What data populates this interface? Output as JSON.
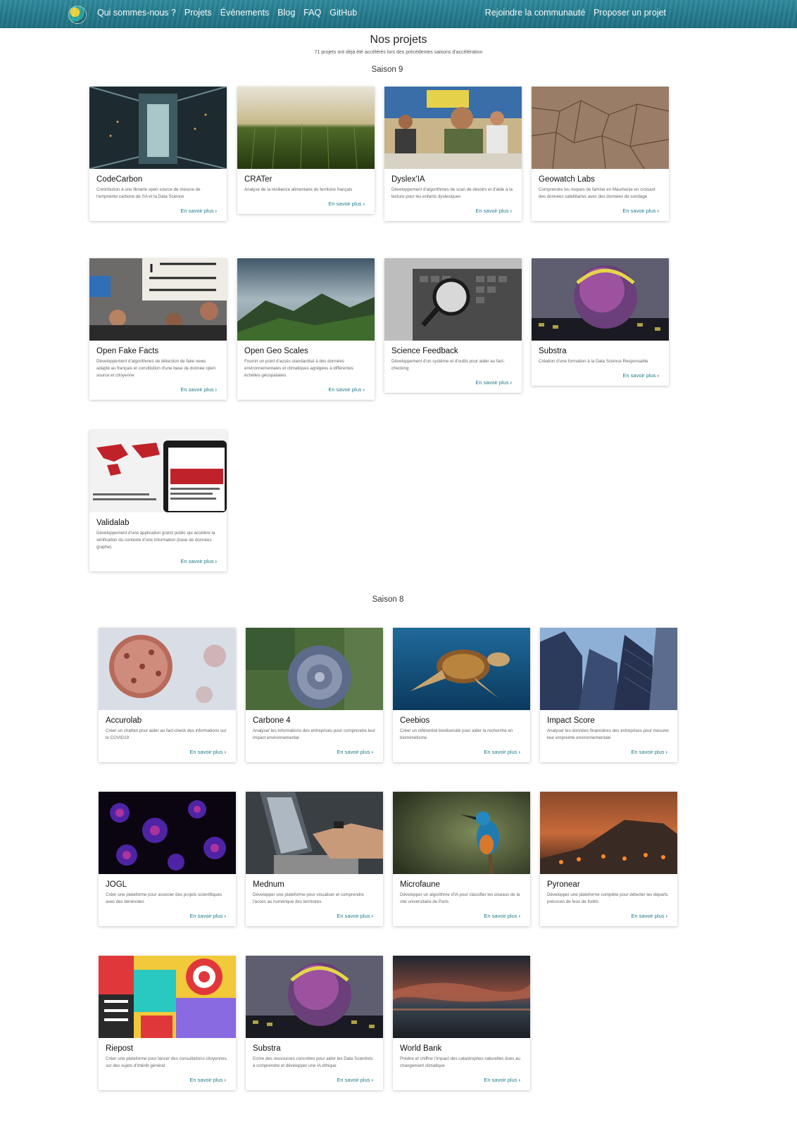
{
  "nav": {
    "left": [
      "Qui sommes-nous ?",
      "Projets",
      "Évènements",
      "Blog",
      "FAQ",
      "GitHub"
    ],
    "right": [
      "Rejoindre la communauté",
      "Proposer un projet"
    ]
  },
  "page": {
    "title": "Nos projets",
    "subtitle": "71 projets ont déjà été accélérés lors des précédentes saisons d'accélération"
  },
  "more_label": "En savoir plus",
  "seasons": [
    {
      "title": "Saison 9",
      "projects": [
        {
          "name": "CodeCarbon",
          "desc": "Contribution à une librairie open source de mesure de l'empreinte carbone de l'IA et la Data Science"
        },
        {
          "name": "CRATer",
          "desc": "Analyse de la résilience alimentaire du territoire français"
        },
        {
          "name": "Dyslex'IA",
          "desc": "Développement d'algorithmes de scan de devoirs et d'aide à la lecture pour les enfants dyslexiques"
        },
        {
          "name": "Geowatch Labs",
          "desc": "Comprendre les risques de famine en Mauritanie en croisant des données satellitaires avec des données de sondage"
        },
        {
          "name": "Open Fake Facts",
          "desc": "Développement d'algorithmes de détection de fake news adapté au français et constitution d'une base de donnée open source et citoyenne"
        },
        {
          "name": "Open Geo Scales",
          "desc": "Fournir un point d'accès standardisé à des données environnementales et climatiques agrégées à différentes échelles géospatiales"
        },
        {
          "name": "Science Feedback",
          "desc": "Développement d'un système et d'outils pour aider au fact-checking"
        },
        {
          "name": "Substra",
          "desc": "Création d'une formation à la Data Science Responsable"
        },
        {
          "name": "Validalab",
          "desc": "Développement d'une application grand public qui accélère la vérification du contexte d'une information (base de données graphe)"
        }
      ]
    },
    {
      "title": "Saison 8",
      "projects": [
        {
          "name": "Accurolab",
          "desc": "Créer un chatbot pour aider au fact-check des informations sur le COVID19"
        },
        {
          "name": "Carbone 4",
          "desc": "Analyser les informations des entreprises pour comprendre leur impact environnemental"
        },
        {
          "name": "Ceebios",
          "desc": "Créer un référentiel biodiversité pour aider la recherche en biomimétisme"
        },
        {
          "name": "Impact Score",
          "desc": "Analyser les données financières des entreprises pour mesurer leur empreinte environnementale"
        },
        {
          "name": "JOGL",
          "desc": "Créer une plateforme pour associer des projets scientifiques avec des bénévoles"
        },
        {
          "name": "Mednum",
          "desc": "Développer une plateforme pour visualiser et comprendre l'accès au numérique des territoires"
        },
        {
          "name": "Microfaune",
          "desc": "Développer un algorithme d'IA pour classifier les oiseaux de la cité universitaire de Paris"
        },
        {
          "name": "Pyronear",
          "desc": "Développer une plateforme complète pour détecter les départs précoces de feux de forêts"
        },
        {
          "name": "Riepost",
          "desc": "Créer une plateforme pour lancer des consultations citoyennes sur des sujets d'intérêt général"
        },
        {
          "name": "Substra",
          "desc": "Ecrire des ressources concrètes pour aider les Data Scientists à comprendre et développer une IA éthique"
        },
        {
          "name": "World Bank",
          "desc": "Prédire et chiffrer l'impact des catastrophes naturelles dues au changement climatique"
        }
      ]
    }
  ]
}
